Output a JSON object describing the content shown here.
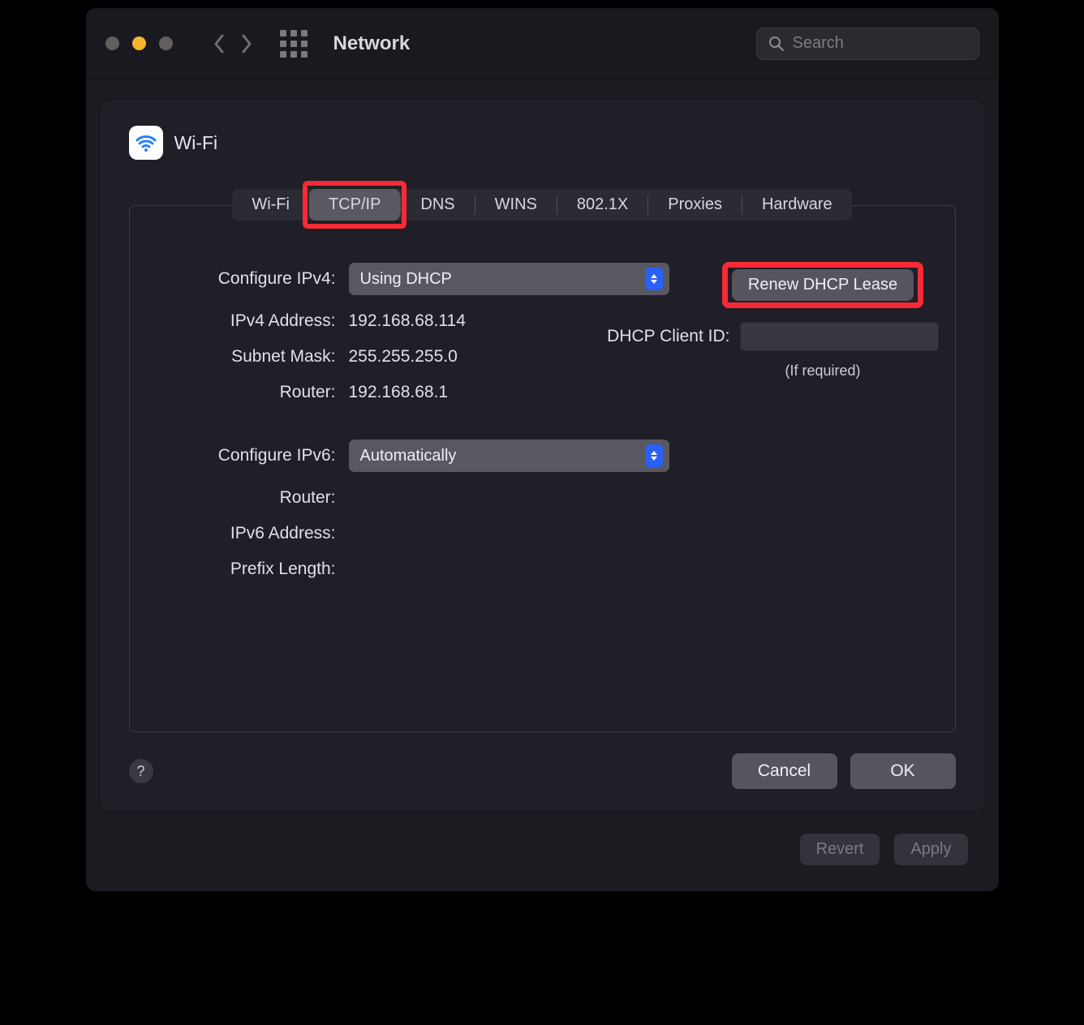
{
  "window": {
    "title": "Network",
    "search_placeholder": "Search"
  },
  "sheet": {
    "icon_label": "Wi-Fi",
    "tabs": [
      {
        "label": "Wi-Fi",
        "selected": false,
        "highlight": false
      },
      {
        "label": "TCP/IP",
        "selected": true,
        "highlight": true
      },
      {
        "label": "DNS",
        "selected": false,
        "highlight": false
      },
      {
        "label": "WINS",
        "selected": false,
        "highlight": false
      },
      {
        "label": "802.1X",
        "selected": false,
        "highlight": false
      },
      {
        "label": "Proxies",
        "selected": false,
        "highlight": false
      },
      {
        "label": "Hardware",
        "selected": false,
        "highlight": false
      }
    ],
    "ipv4": {
      "configure_label": "Configure IPv4:",
      "configure_value": "Using DHCP",
      "address_label": "IPv4 Address:",
      "address_value": "192.168.68.114",
      "subnet_label": "Subnet Mask:",
      "subnet_value": "255.255.255.0",
      "router_label": "Router:",
      "router_value": "192.168.68.1"
    },
    "dhcp": {
      "renew_label": "Renew DHCP Lease",
      "client_id_label": "DHCP Client ID:",
      "client_id_value": "",
      "required_note": "(If required)"
    },
    "ipv6": {
      "configure_label": "Configure IPv6:",
      "configure_value": "Automatically",
      "router_label": "Router:",
      "router_value": "",
      "address_label": "IPv6 Address:",
      "address_value": "",
      "prefix_label": "Prefix Length:",
      "prefix_value": ""
    },
    "footer": {
      "cancel": "Cancel",
      "ok": "OK"
    }
  },
  "window_footer": {
    "revert": "Revert",
    "apply": "Apply"
  }
}
